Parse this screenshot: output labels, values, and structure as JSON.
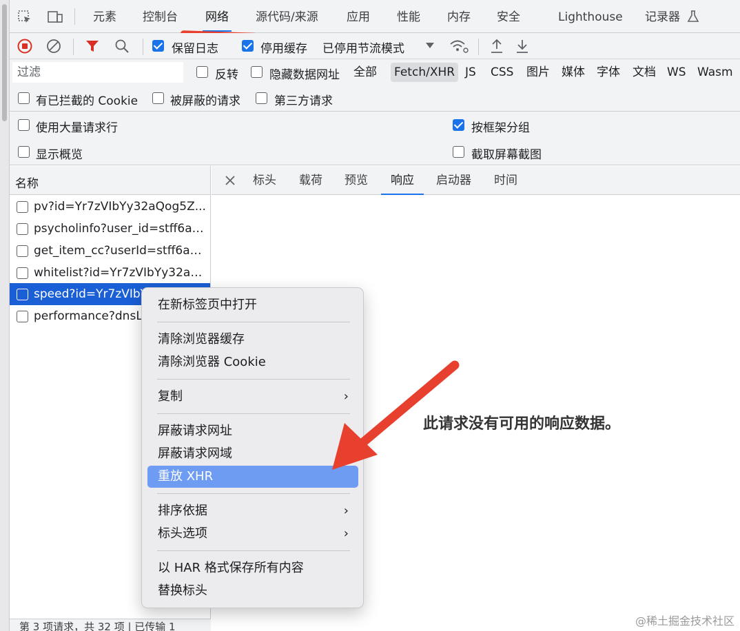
{
  "tabs": [
    "元素",
    "控制台",
    "网络",
    "源代码/来源",
    "应用",
    "性能",
    "内存",
    "安全",
    "Lighthouse",
    "记录器"
  ],
  "toolbar": {
    "preserve_log": "保留日志",
    "disable_cache": "停用缓存",
    "throttle": "已停用节流模式"
  },
  "filter": {
    "placeholder": "过滤",
    "invert": "反转",
    "hide_data_urls": "隐藏数据网址",
    "types": [
      "全部",
      "Fetch/XHR",
      "JS",
      "CSS",
      "图片",
      "媒体",
      "字体",
      "文档",
      "WS",
      "Wasm"
    ],
    "blocked_cookies": "有已拦截的 Cookie",
    "blocked_requests": "被屏蔽的请求",
    "third_party": "第三方请求"
  },
  "settings": {
    "big_rows": "使用大量请求行",
    "group_by_frame": "按框架分组",
    "overview": "显示概览",
    "screenshots": "截取屏幕截图"
  },
  "list": {
    "header": "名称",
    "requests": [
      "pv?id=Yr7zVIbYy32aQog5Z...",
      "psycholinfo?user_id=stff6a7...",
      "get_item_cc?userId=stff6a7...",
      "whitelist?id=Yr7zVIbYy32aQ...",
      "speed?id=Yr7zVIbY",
      "performance?dnsLo"
    ],
    "status": "第 3 项请求，共 32 项 | 已传输 1"
  },
  "detail": {
    "tabs": [
      "标头",
      "载荷",
      "预览",
      "响应",
      "启动器",
      "时间"
    ],
    "empty_message": "此请求没有可用的响应数据。"
  },
  "context_menu": {
    "items": [
      "在新标签页中打开",
      "清除浏览器缓存",
      "清除浏览器 Cookie",
      "复制",
      "屏蔽请求网址",
      "屏蔽请求网域",
      "重放 XHR",
      "排序依据",
      "标头选项",
      "以 HAR 格式保存所有内容",
      "替换标头"
    ],
    "chevron": "›"
  },
  "watermark": "@稀土掘金技术社区",
  "colors": {
    "accent": "#1a73e8",
    "selection": "#1a5fd6",
    "menu_highlight": "#6d9cf2",
    "annotation_red": "#e8402e"
  }
}
